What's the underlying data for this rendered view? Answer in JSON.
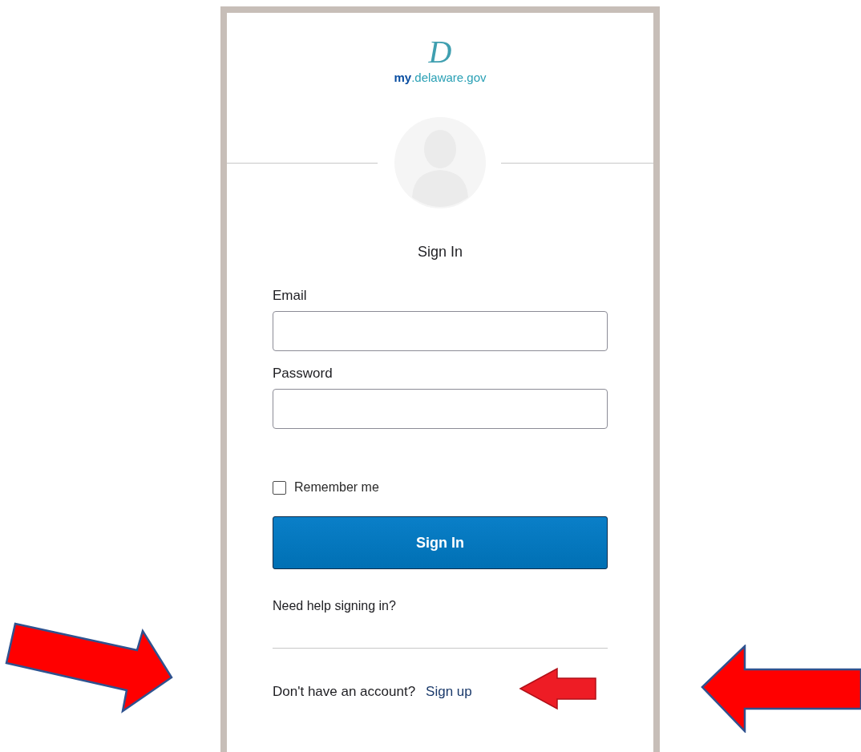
{
  "logo": {
    "mark": "D",
    "text": "**my**.delaware.gov"
  },
  "title": "Sign In",
  "fields": [
    {
      "label": "Email"
    },
    {
      "label": "Password"
    }
  ],
  "remember": {
    "label": "Remember me",
    "checked": false
  },
  "button": "Sign In",
  "help_link": "Need help signing in?",
  "signup": {
    "prompt": "Don't have an account?",
    "link": "Sign up"
  },
  "annotations": [
    {
      "kind": "arrow-right"
    },
    {
      "kind": "arrow-left-small"
    },
    {
      "kind": "arrow-left"
    }
  ]
}
